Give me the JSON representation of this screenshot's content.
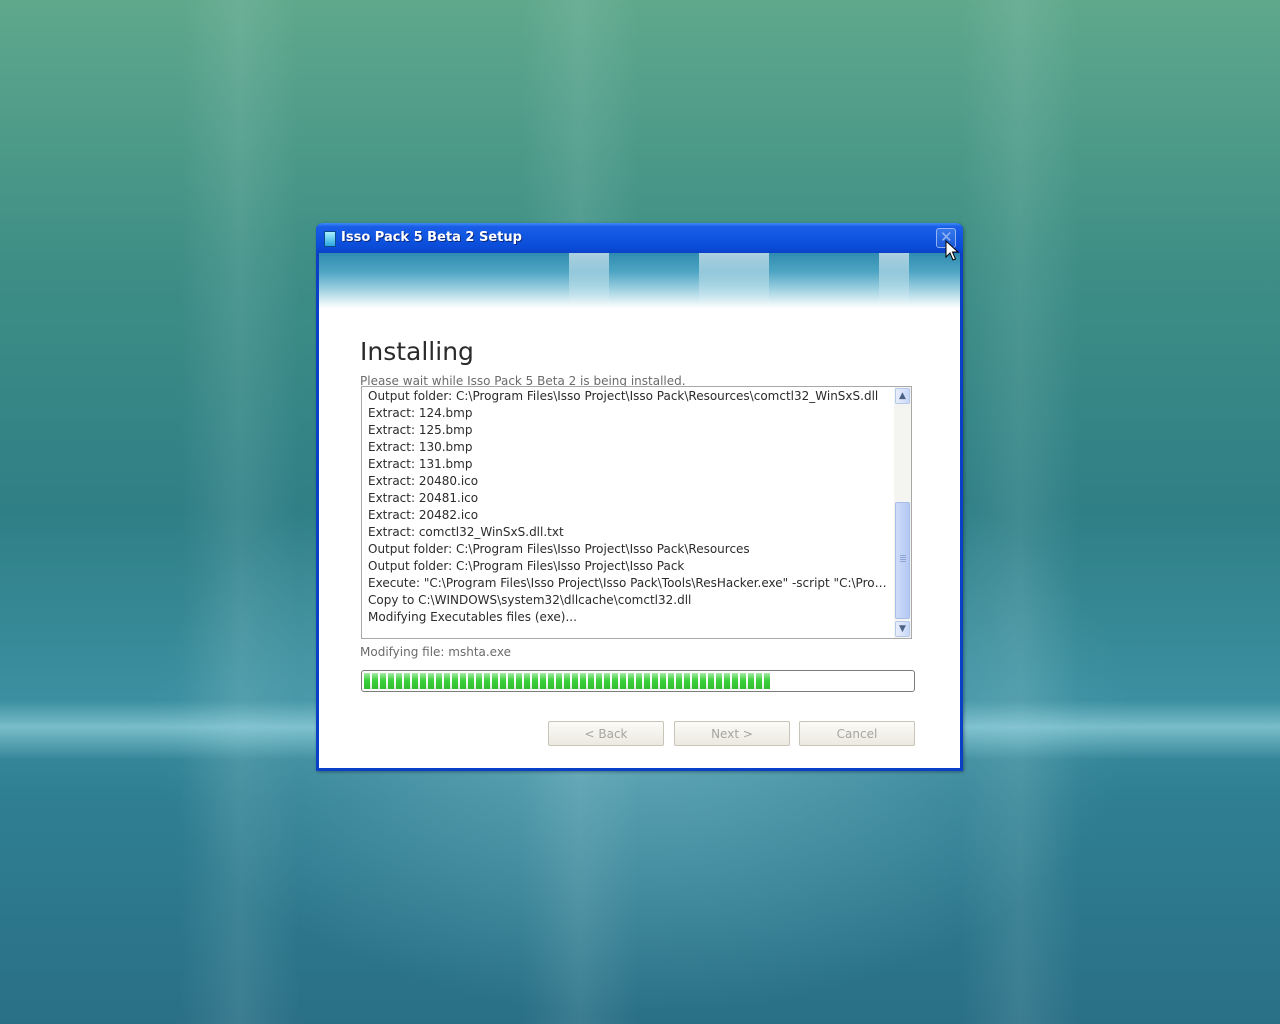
{
  "window": {
    "title": "Isso Pack 5 Beta 2 Setup",
    "close_symbol": "✕"
  },
  "page": {
    "title": "Installing",
    "subtitle": "Please wait while Isso Pack 5 Beta 2 is being installed."
  },
  "log": {
    "lines": [
      "Output folder: C:\\Program Files\\Isso Project\\Isso Pack\\Resources\\comctl32_WinSxS.dll",
      "Extract: 124.bmp",
      "Extract: 125.bmp",
      "Extract: 130.bmp",
      "Extract: 131.bmp",
      "Extract: 20480.ico",
      "Extract: 20481.ico",
      "Extract: 20482.ico",
      "Extract: comctl32_WinSxS.dll.txt",
      "Output folder: C:\\Program Files\\Isso Project\\Isso Pack\\Resources",
      "Output folder: C:\\Program Files\\Isso Project\\Isso Pack",
      "Execute: \"C:\\Program Files\\Isso Project\\Isso Pack\\Tools\\ResHacker.exe\" -script \"C:\\Prog...",
      "Copy to C:\\WINDOWS\\system32\\dllcache\\comctl32.dll",
      "Modifying Executables files (exe)..."
    ],
    "scroll_up_icon": "▲",
    "scroll_down_icon": "▼"
  },
  "status": {
    "text": "Modifying file: mshta.exe",
    "progress_fraction": 0.74
  },
  "buttons": {
    "back": "< Back",
    "next": "Next >",
    "cancel": "Cancel"
  },
  "colors": {
    "titlebar": "#0a4ad6",
    "progress": "#3bd13b"
  }
}
